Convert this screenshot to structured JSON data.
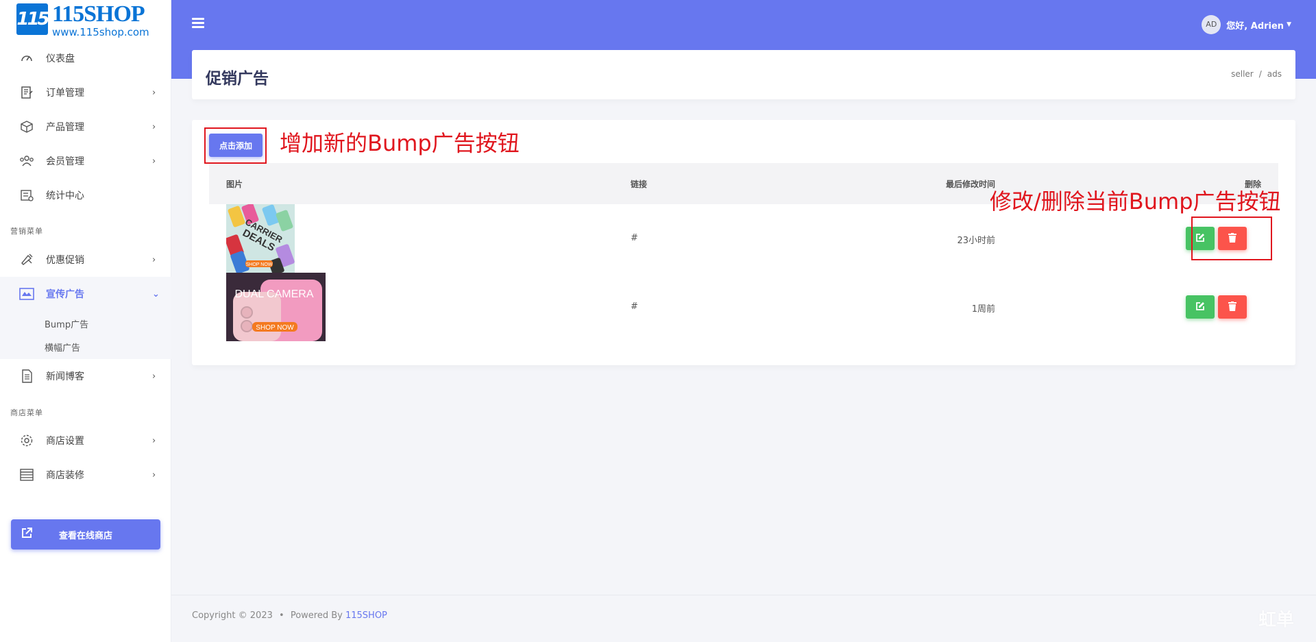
{
  "brand": {
    "mark": "115",
    "name": "115SHOP",
    "url": "www.115shop.com",
    "color": "#0a74d6"
  },
  "sidebar": {
    "items": [
      {
        "label": "仪表盘",
        "icon": "dashboard-icon"
      },
      {
        "label": "订单管理",
        "icon": "orders-icon"
      },
      {
        "label": "产品管理",
        "icon": "box-icon"
      },
      {
        "label": "会员管理",
        "icon": "users-icon"
      },
      {
        "label": "统计中心",
        "icon": "stats-icon"
      },
      {
        "label": "优惠促销",
        "icon": "megaphone-icon"
      },
      {
        "label": "宣传广告",
        "icon": "ad-icon"
      },
      {
        "label": "新闻博客",
        "icon": "news-icon"
      },
      {
        "label": "商店设置",
        "icon": "gear-icon"
      },
      {
        "label": "商店装修",
        "icon": "layout-icon"
      }
    ],
    "marketing_header": "营销菜单",
    "shop_header": "商店菜单",
    "ad_subitems": [
      "Bump广告",
      "横幅广告"
    ],
    "store_button": "查看在线商店"
  },
  "topbar": {
    "avatar": "AD",
    "greeting": "您好, Adrien"
  },
  "page": {
    "title": "促销广告",
    "breadcrumb": [
      "seller",
      "/",
      "ads"
    ]
  },
  "toolbar": {
    "add_label": "点击添加"
  },
  "annotations": {
    "add": "增加新的Bump广告按钮",
    "edit_delete": "修改/删除当前Bump广告按钮"
  },
  "table": {
    "headers": [
      "图片",
      "链接",
      "最后修改时间",
      "删除"
    ],
    "rows": [
      {
        "image_text_1": "CARRIER",
        "image_text_2": "DEALS",
        "image_cta": "SHOP NOW",
        "link": "#",
        "time": "23小时前"
      },
      {
        "image_text_1": "DUAL CAMERA",
        "image_cta": "SHOP NOW",
        "link": "#",
        "time": "1周前"
      }
    ]
  },
  "footer": {
    "copyright": "Copyright © 2023",
    "dot": "•",
    "powered": "Powered By",
    "brand": "115SHOP"
  },
  "watermark": "虹单",
  "colors": {
    "primary": "#6777ef",
    "success": "#47c363",
    "danger": "#fc544b",
    "annotation": "#e0161e"
  }
}
